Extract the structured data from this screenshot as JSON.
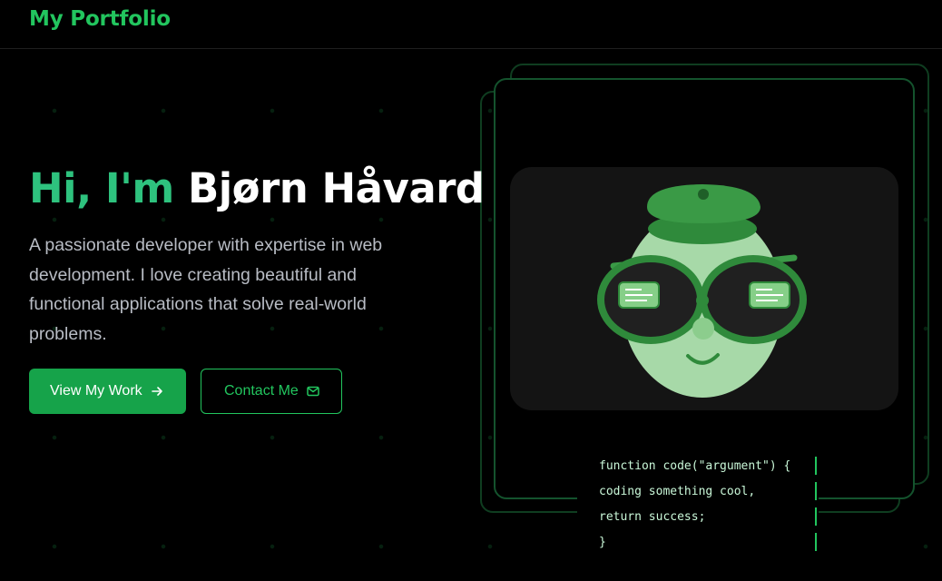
{
  "header": {
    "brand": "My Portfolio"
  },
  "hero": {
    "greeting": "Hi, I'm",
    "name": "Bjørn Håvard",
    "description": "A passionate developer with expertise in web development. I love creating beautiful and functional applications that solve real-world problems.",
    "primary_button": {
      "label": "View My Work",
      "icon": "arrow-right-icon"
    },
    "secondary_button": {
      "label": "Contact Me",
      "icon": "mail-icon"
    }
  },
  "code_snippet": {
    "lines": [
      "function code(\"argument\") {",
      "coding something cool,",
      "return success;",
      "}"
    ]
  },
  "colors": {
    "accent": "#22c55e",
    "button": "#16a34a",
    "background": "#000000",
    "text_muted": "#b8bcc4"
  }
}
